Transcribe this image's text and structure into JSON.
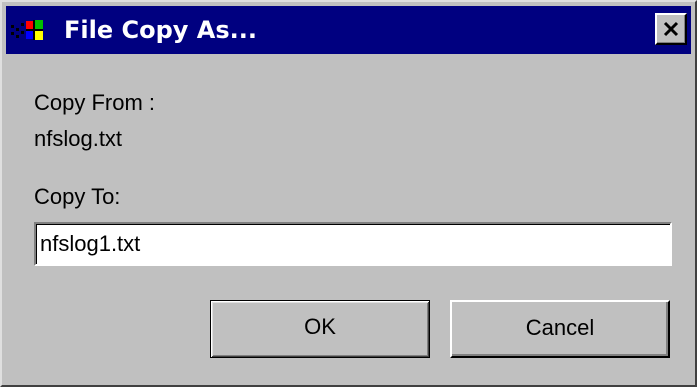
{
  "window": {
    "title": "File Copy As...",
    "icon": "windows-flag-icon",
    "close_icon": "close-icon"
  },
  "form": {
    "copy_from_label": "Copy From :",
    "copy_from_value": "nfslog.txt",
    "copy_to_label": "Copy To:",
    "copy_to_value": "nfslog1.txt"
  },
  "buttons": {
    "ok_label": "OK",
    "cancel_label": "Cancel"
  },
  "colors": {
    "titlebar": "#000080",
    "face": "#c0c0c0",
    "input_bg": "#ffffff"
  }
}
